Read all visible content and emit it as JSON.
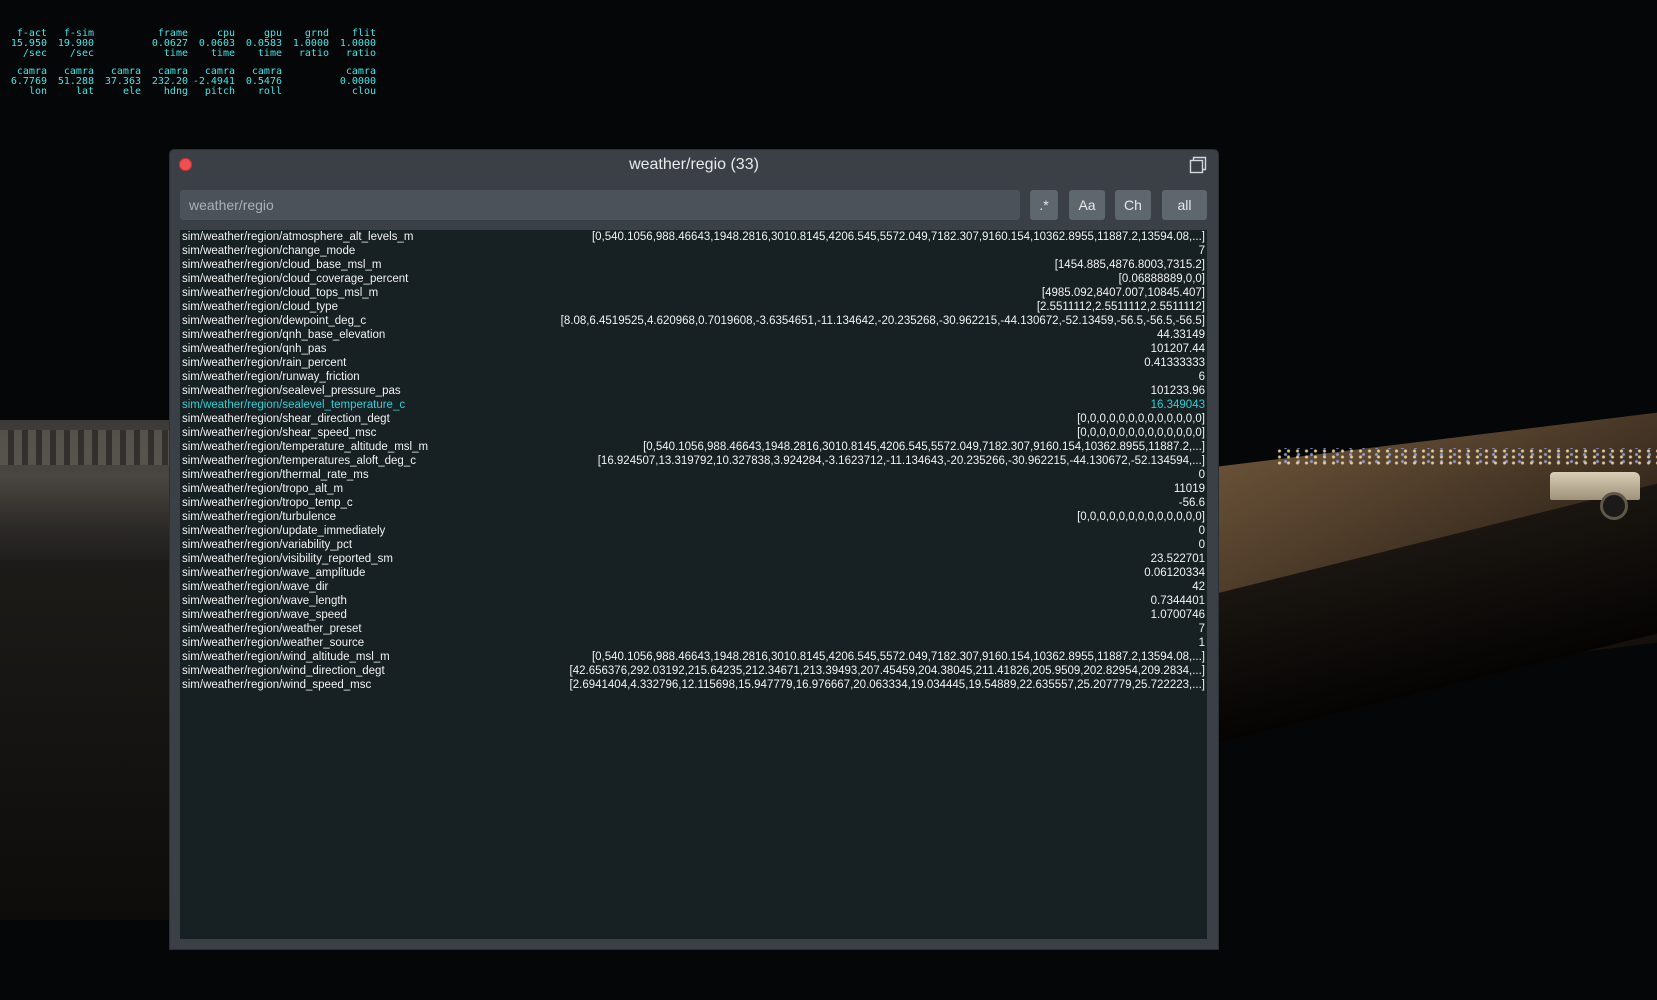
{
  "stats": {
    "row1": [
      {
        "name": "f-act",
        "value": "15.950",
        "unit": "/sec"
      },
      {
        "name": "f-sim",
        "value": "19.900",
        "unit": "/sec"
      },
      {
        "name": "",
        "value": "",
        "unit": ""
      },
      {
        "name": "frame",
        "value": "0.0627",
        "unit": "time"
      },
      {
        "name": "cpu",
        "value": "0.0603",
        "unit": "time"
      },
      {
        "name": "gpu",
        "value": "0.0583",
        "unit": "time"
      },
      {
        "name": "grnd",
        "value": "1.0000",
        "unit": "ratio"
      },
      {
        "name": "flit",
        "value": "1.0000",
        "unit": "ratio"
      }
    ],
    "row2": [
      {
        "name": "camra",
        "value": "6.7769",
        "unit": "lon"
      },
      {
        "name": "camra",
        "value": "51.288",
        "unit": "lat"
      },
      {
        "name": "camra",
        "value": "37.363",
        "unit": "ele"
      },
      {
        "name": "camra",
        "value": "232.20",
        "unit": "hdng"
      },
      {
        "name": "camra",
        "value": "-2.4941",
        "unit": "pitch"
      },
      {
        "name": "camra",
        "value": "0.5476",
        "unit": "roll"
      },
      {
        "name": "",
        "value": "",
        "unit": ""
      },
      {
        "name": "camra",
        "value": "0.0000",
        "unit": "clou"
      }
    ]
  },
  "window": {
    "title": "weather/regio (33)",
    "search_value": "weather/regio",
    "buttons": {
      "regex": ".*",
      "case": "Aa",
      "ch": "Ch",
      "all": "all"
    },
    "close_color": "#ef4f4f",
    "selected_color": "#2ecfd4"
  },
  "datarefs": [
    {
      "name": "sim/weather/region/atmosphere_alt_levels_m",
      "value": "[0,540.1056,988.46643,1948.2816,3010.8145,4206.545,5572.049,7182.307,9160.154,10362.8955,11887.2,13594.08,...]"
    },
    {
      "name": "sim/weather/region/change_mode",
      "value": "7"
    },
    {
      "name": "sim/weather/region/cloud_base_msl_m",
      "value": "[1454.885,4876.8003,7315.2]"
    },
    {
      "name": "sim/weather/region/cloud_coverage_percent",
      "value": "[0.06888889,0,0]"
    },
    {
      "name": "sim/weather/region/cloud_tops_msl_m",
      "value": "[4985.092,8407.007,10845.407]"
    },
    {
      "name": "sim/weather/region/cloud_type",
      "value": "[2.5511112,2.5511112,2.5511112]"
    },
    {
      "name": "sim/weather/region/dewpoint_deg_c",
      "value": "[8.08,6.4519525,4.620968,0.7019608,-3.6354651,-11.134642,-20.235268,-30.962215,-44.130672,-52.13459,-56.5,-56.5,-56.5]"
    },
    {
      "name": "sim/weather/region/qnh_base_elevation",
      "value": "44.33149"
    },
    {
      "name": "sim/weather/region/qnh_pas",
      "value": "101207.44"
    },
    {
      "name": "sim/weather/region/rain_percent",
      "value": "0.41333333"
    },
    {
      "name": "sim/weather/region/runway_friction",
      "value": "6"
    },
    {
      "name": "sim/weather/region/sealevel_pressure_pas",
      "value": "101233.96"
    },
    {
      "name": "sim/weather/region/sealevel_temperature_c",
      "value": "16.349043",
      "selected": true
    },
    {
      "name": "sim/weather/region/shear_direction_degt",
      "value": "[0,0,0,0,0,0,0,0,0,0,0,0,0]"
    },
    {
      "name": "sim/weather/region/shear_speed_msc",
      "value": "[0,0,0,0,0,0,0,0,0,0,0,0,0]"
    },
    {
      "name": "sim/weather/region/temperature_altitude_msl_m",
      "value": "[0,540.1056,988.46643,1948.2816,3010.8145,4206.545,5572.049,7182.307,9160.154,10362.8955,11887.2,...]"
    },
    {
      "name": "sim/weather/region/temperatures_aloft_deg_c",
      "value": "[16.924507,13.319792,10.327838,3.924284,-3.1623712,-11.134643,-20.235266,-30.962215,-44.130672,-52.134594,...]"
    },
    {
      "name": "sim/weather/region/thermal_rate_ms",
      "value": "0"
    },
    {
      "name": "sim/weather/region/tropo_alt_m",
      "value": "11019"
    },
    {
      "name": "sim/weather/region/tropo_temp_c",
      "value": "-56.6"
    },
    {
      "name": "sim/weather/region/turbulence",
      "value": "[0,0,0,0,0,0,0,0,0,0,0,0,0]"
    },
    {
      "name": "sim/weather/region/update_immediately",
      "value": "0"
    },
    {
      "name": "sim/weather/region/variability_pct",
      "value": "0"
    },
    {
      "name": "sim/weather/region/visibility_reported_sm",
      "value": "23.522701"
    },
    {
      "name": "sim/weather/region/wave_amplitude",
      "value": "0.06120334"
    },
    {
      "name": "sim/weather/region/wave_dir",
      "value": "42"
    },
    {
      "name": "sim/weather/region/wave_length",
      "value": "0.7344401"
    },
    {
      "name": "sim/weather/region/wave_speed",
      "value": "1.0700746"
    },
    {
      "name": "sim/weather/region/weather_preset",
      "value": "7"
    },
    {
      "name": "sim/weather/region/weather_source",
      "value": "1"
    },
    {
      "name": "sim/weather/region/wind_altitude_msl_m",
      "value": "[0,540.1056,988.46643,1948.2816,3010.8145,4206.545,5572.049,7182.307,9160.154,10362.8955,11887.2,13594.08,...]"
    },
    {
      "name": "sim/weather/region/wind_direction_degt",
      "value": "[42.656376,292.03192,215.64235,212.34671,213.39493,207.45459,204.38045,211.41826,205.9509,202.82954,209.2834,...]"
    },
    {
      "name": "sim/weather/region/wind_speed_msc",
      "value": "[2.6941404,4.332796,12.115698,15.947779,16.976667,20.063334,19.034445,19.54889,22.635557,25.207779,25.722223,...]"
    }
  ]
}
